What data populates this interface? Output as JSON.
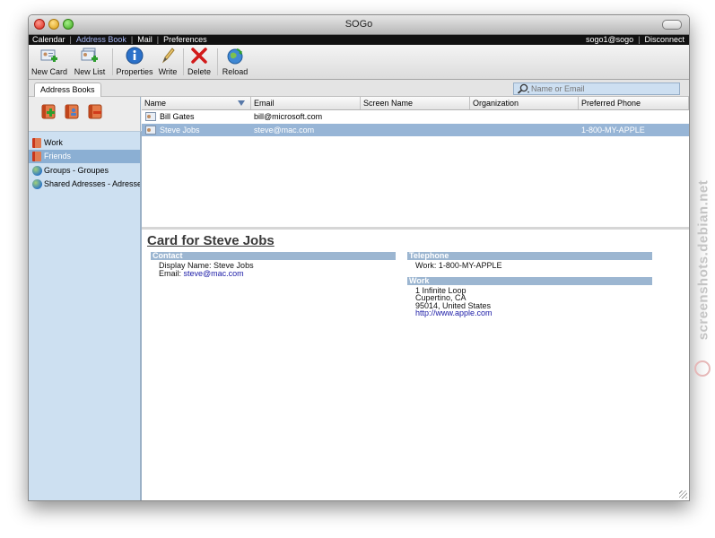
{
  "window": {
    "title": "SOGo"
  },
  "menubar": {
    "items": [
      {
        "label": "Calendar",
        "active": false
      },
      {
        "label": "Address Book",
        "active": true
      },
      {
        "label": "Mail",
        "active": false
      },
      {
        "label": "Preferences",
        "active": false
      }
    ],
    "user": "sogo1@sogo",
    "disconnect_label": "Disconnect"
  },
  "toolbar": {
    "buttons": [
      {
        "label": "New Card",
        "icon": "new-card-icon"
      },
      {
        "label": "New List",
        "icon": "new-list-icon"
      },
      {
        "label": "Properties",
        "icon": "info-icon"
      },
      {
        "label": "Write",
        "icon": "pen-icon"
      },
      {
        "label": "Delete",
        "icon": "delete-x-icon"
      },
      {
        "label": "Reload",
        "icon": "reload-globe-icon"
      }
    ]
  },
  "tabs": {
    "address_books": "Address Books"
  },
  "search": {
    "placeholder": "Name or Email",
    "value": ""
  },
  "sidebar": {
    "items": [
      {
        "label": "Work",
        "icon": "address-book-icon",
        "selected": false
      },
      {
        "label": "Friends",
        "icon": "address-book-icon",
        "selected": true
      },
      {
        "label": "Groups - Groupes",
        "icon": "globe-icon",
        "selected": false
      },
      {
        "label": "Shared Adresses - Adresses",
        "icon": "globe-icon",
        "selected": false
      }
    ]
  },
  "contacts": {
    "columns": [
      "Name",
      "Email",
      "Screen Name",
      "Organization",
      "Preferred Phone"
    ],
    "rows": [
      {
        "name": "Bill Gates",
        "email": "bill@microsoft.com",
        "screen_name": "",
        "organization": "",
        "phone": "",
        "selected": false
      },
      {
        "name": "Steve Jobs",
        "email": "steve@mac.com",
        "screen_name": "",
        "organization": "",
        "phone": "1-800-MY-APPLE",
        "selected": true
      }
    ]
  },
  "card": {
    "title": "Card for Steve Jobs",
    "contact": {
      "heading": "Contact",
      "display_name_label": "Display Name:",
      "display_name": "Steve Jobs",
      "email_label": "Email:",
      "email": "steve@mac.com"
    },
    "telephone": {
      "heading": "Telephone",
      "work_label": "Work:",
      "work": "1-800-MY-APPLE"
    },
    "work": {
      "heading": "Work",
      "street": "1 Infinite Loop",
      "city": "Cupertino, CA",
      "postal": "95014, United States",
      "url": "http://www.apple.com"
    }
  },
  "watermark": {
    "text": "screenshots.debian.net"
  },
  "colors": {
    "accent": "#8bafd3",
    "sidebar": "#cde0f1",
    "section_header": "#9cb6d1",
    "link": "#1a1aa6"
  }
}
